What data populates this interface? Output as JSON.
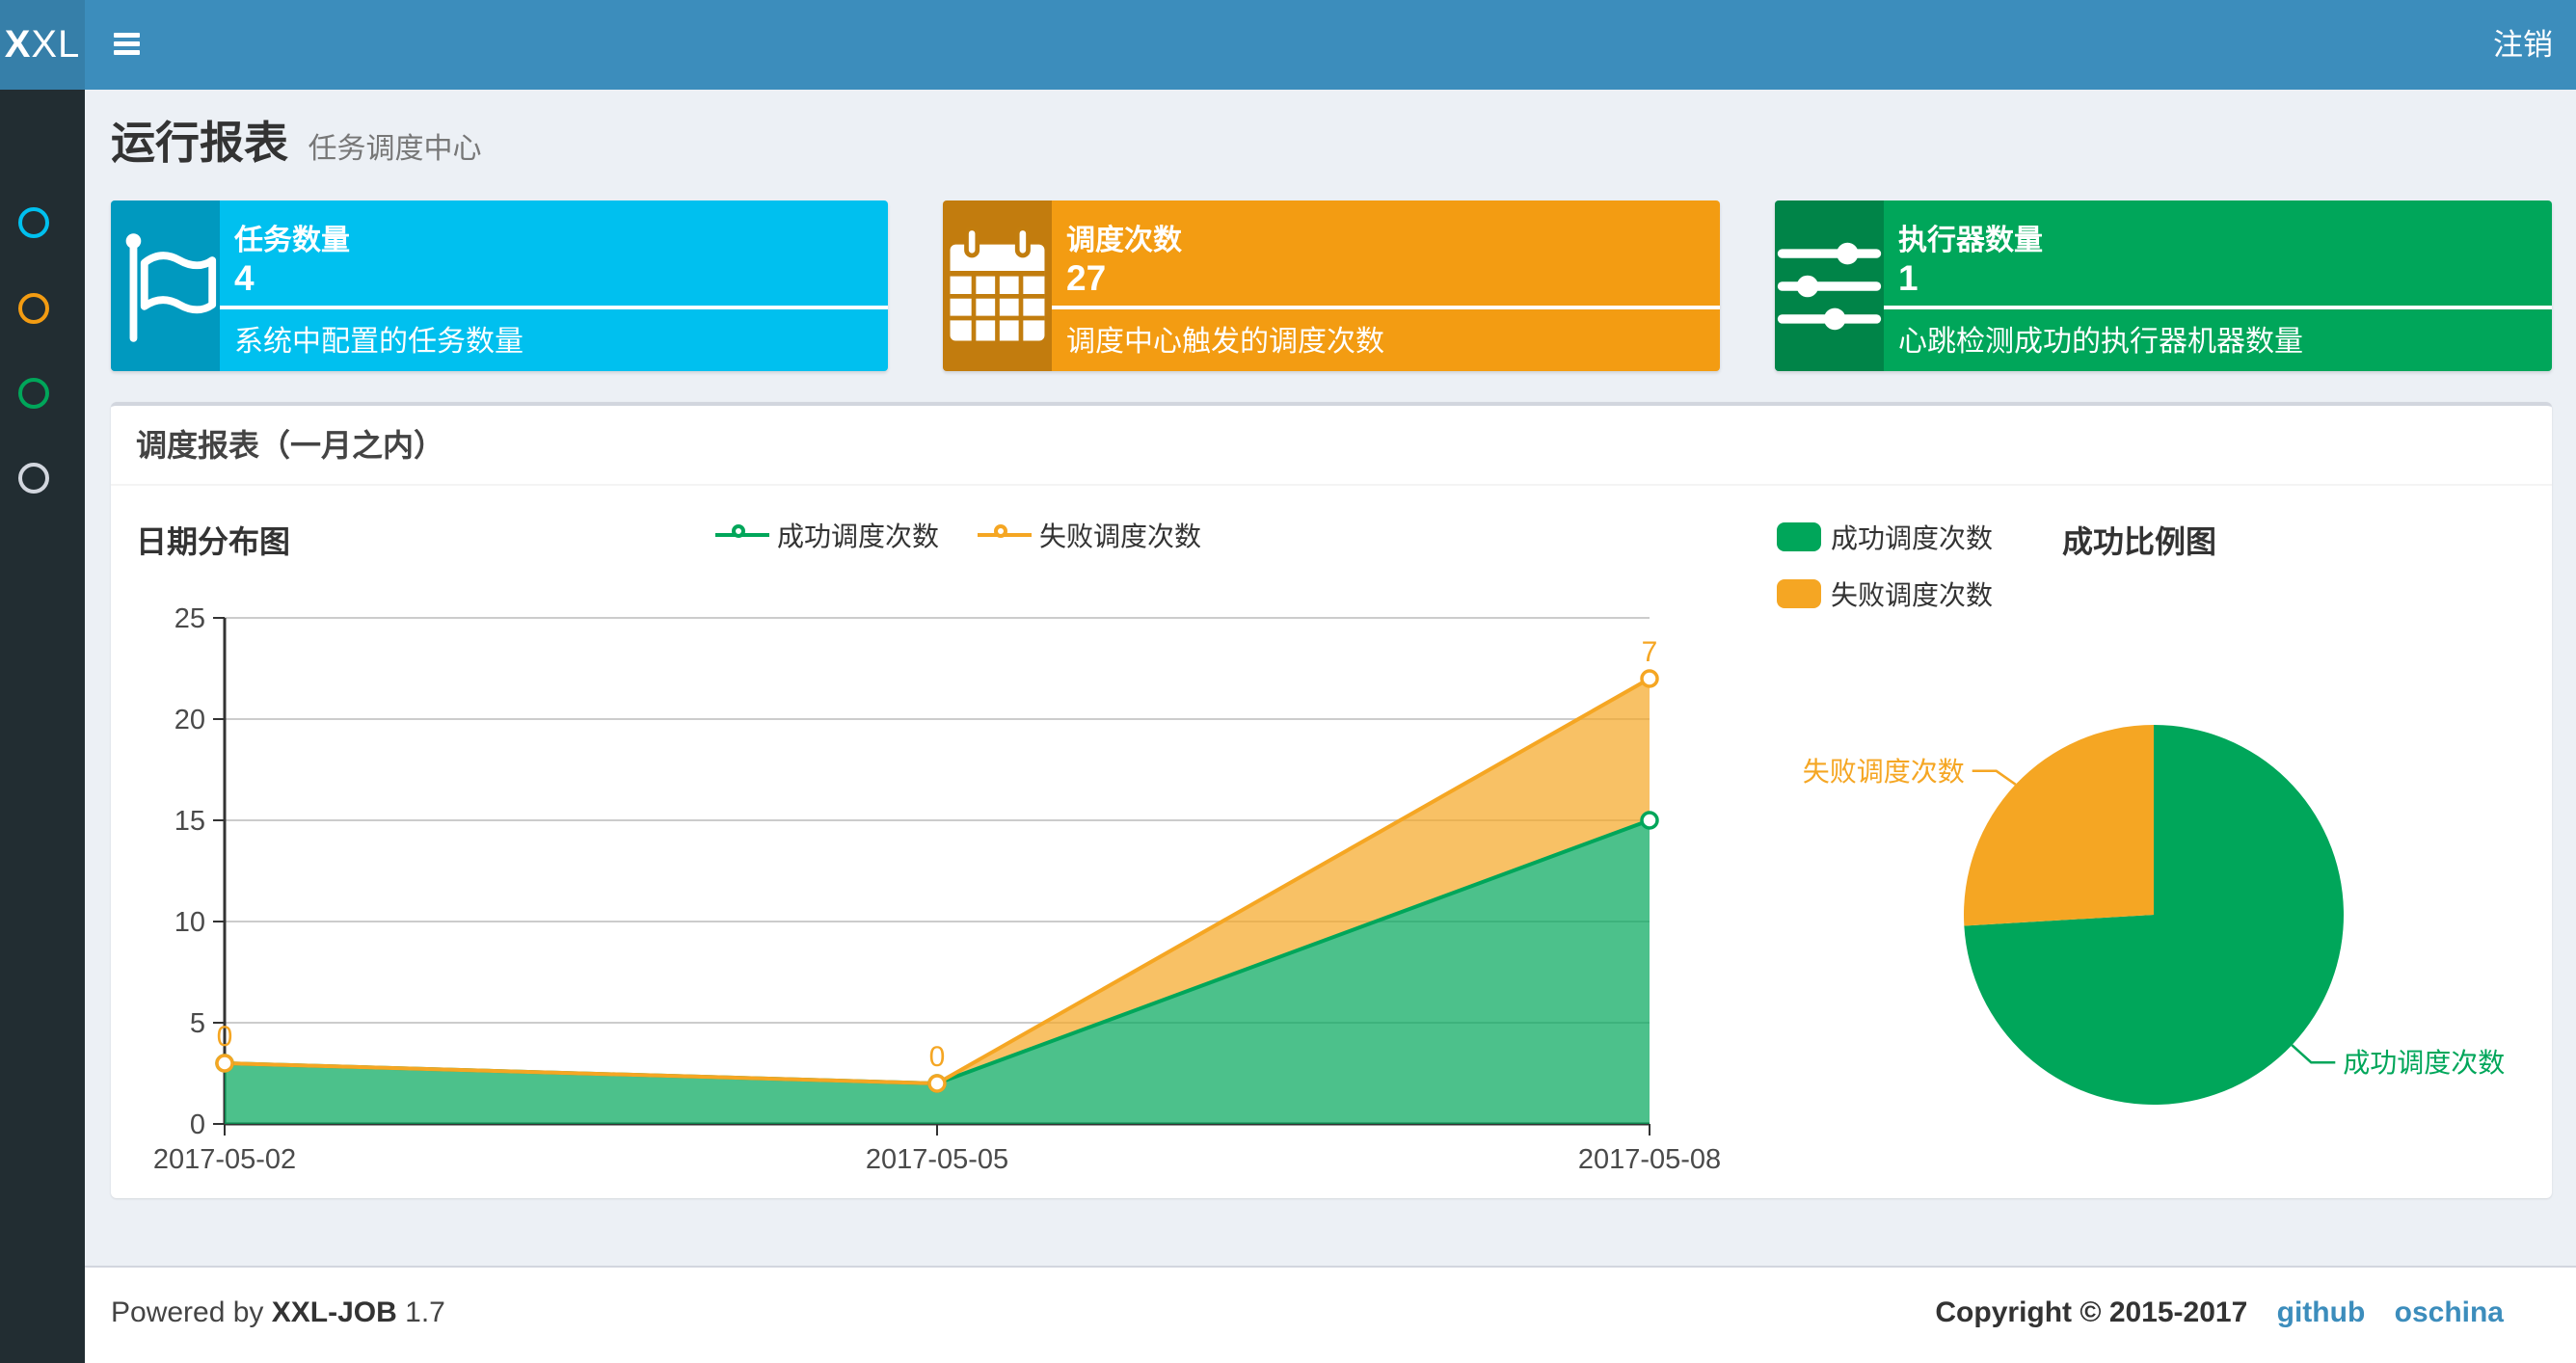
{
  "theme": {
    "header_bg": "#3c8dbc",
    "logo_bg": "#367fa9",
    "sidebar_bg": "#222d32",
    "content_bg": "#ecf0f5",
    "link_color": "#3c8dbc",
    "info": "#00c0ef",
    "warning": "#f39c12",
    "success": "#00a65a",
    "gray": "#d2d6de"
  },
  "header": {
    "logo_bold": "X",
    "logo_rest": "XL",
    "logout_label": "注销"
  },
  "sidebar": {
    "items": [
      {
        "icon": "circle-o-icon",
        "color": "#00c0ef"
      },
      {
        "icon": "circle-o-icon",
        "color": "#f39c12"
      },
      {
        "icon": "circle-o-icon",
        "color": "#00a65a"
      },
      {
        "icon": "circle-o-icon",
        "color": "#d2d6de"
      }
    ]
  },
  "page": {
    "title": "运行报表",
    "subtitle": "任务调度中心"
  },
  "info_boxes": [
    {
      "icon": "flag-outline-icon",
      "label": "任务数量",
      "value": "4",
      "desc": "系统中配置的任务数量",
      "color": "#00c0ef"
    },
    {
      "icon": "calendar-icon",
      "label": "调度次数",
      "value": "27",
      "desc": "调度中心触发的调度次数",
      "color": "#f39c12"
    },
    {
      "icon": "sliders-icon",
      "label": "执行器数量",
      "value": "1",
      "desc": "心跳检测成功的执行器机器数量",
      "color": "#00a65a"
    }
  ],
  "panel": {
    "title": "调度报表（一月之内）"
  },
  "chart_data": [
    {
      "type": "area",
      "title": "日期分布图",
      "stacked": true,
      "x": [
        "2017-05-02",
        "2017-05-05",
        "2017-05-08"
      ],
      "series": [
        {
          "name": "成功调度次数",
          "values": [
            3,
            2,
            15
          ],
          "color": "#00a65a"
        },
        {
          "name": "失败调度次数",
          "values": [
            0,
            0,
            7
          ],
          "color": "#f5a623"
        }
      ],
      "data_labels_series": "失败调度次数",
      "data_labels": [
        0,
        0,
        7
      ],
      "ylim": [
        0,
        25
      ],
      "yticks": [
        0,
        5,
        10,
        15,
        20,
        25
      ],
      "grid": true,
      "legend_position": "top-center"
    },
    {
      "type": "pie",
      "title": "成功比例图",
      "slices": [
        {
          "name": "成功调度次数",
          "value": 20,
          "color": "#00a65a"
        },
        {
          "name": "失败调度次数",
          "value": 7,
          "color": "#f5a623"
        }
      ],
      "start_angle": "top",
      "direction": "clockwise",
      "legend_position": "top-left"
    }
  ],
  "footer": {
    "powered_prefix": "Powered by",
    "app_name": "XXL-JOB",
    "version": "1.7",
    "copyright": "Copyright © 2015-2017",
    "links": [
      {
        "label": "github"
      },
      {
        "label": "oschina"
      }
    ]
  }
}
